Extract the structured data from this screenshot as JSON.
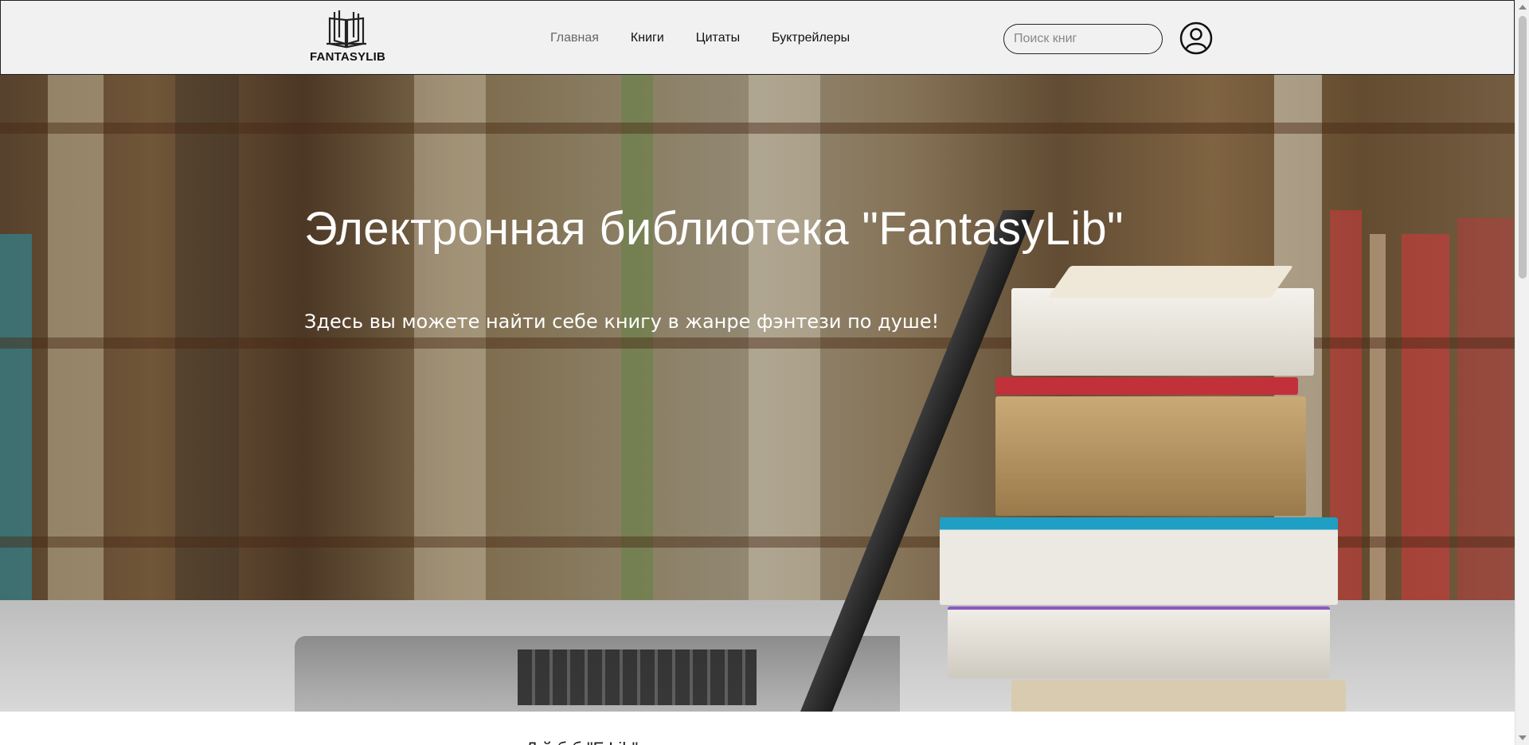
{
  "header": {
    "logo_text": "FANTASYLIB",
    "nav": [
      {
        "label": "Главная",
        "active": true
      },
      {
        "label": "Книги",
        "active": false
      },
      {
        "label": "Цитаты",
        "active": false
      },
      {
        "label": "Буктрейлеры",
        "active": false
      }
    ],
    "search": {
      "placeholder": "Поиск книг",
      "icon": "search-icon"
    },
    "account_icon": "user-icon"
  },
  "hero": {
    "title": "Электронная библиотека \"FantasyLib\"",
    "subtitle": "Здесь вы можете найти себе книгу в жанре фэнтези по душе!"
  },
  "below": {
    "partial_text": "Д                                       й б б        \"F       Lib\""
  },
  "colors": {
    "header_bg": "#f1f1f1",
    "active_nav": "#666666",
    "text": "#111111"
  }
}
